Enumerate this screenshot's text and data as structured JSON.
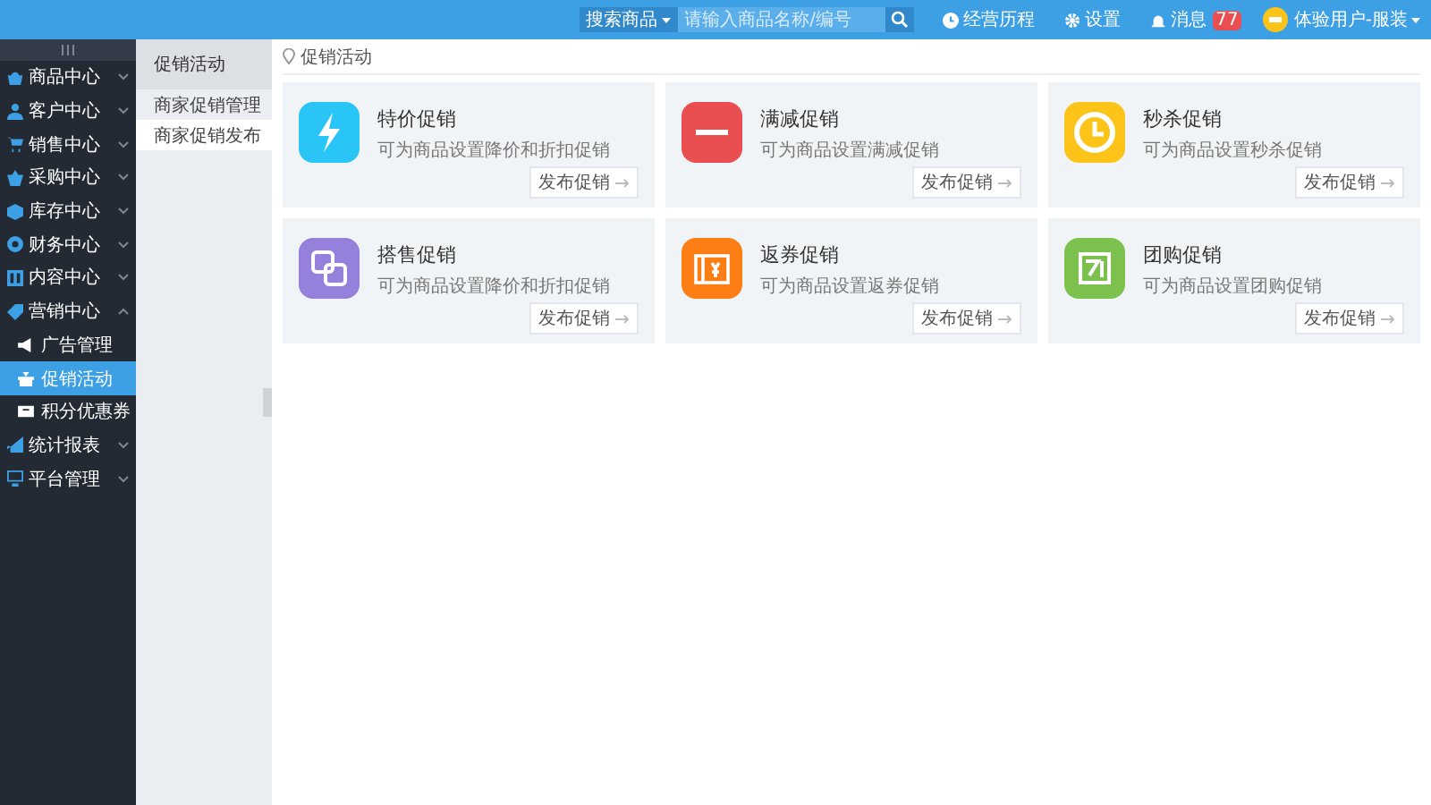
{
  "topbar": {
    "search": {
      "scope": "搜索商品",
      "placeholder": "请输入商品名称/编号"
    },
    "links": [
      {
        "kind": "history",
        "label": "经营历程"
      },
      {
        "kind": "settings",
        "label": "设置"
      },
      {
        "kind": "bell",
        "label": "消息",
        "badge": "77"
      }
    ],
    "user": "体验用户-服装"
  },
  "sidebar": {
    "items": [
      {
        "kind": "bag",
        "label": "商品中心",
        "expanded": false
      },
      {
        "kind": "person",
        "label": "客户中心",
        "expanded": false
      },
      {
        "kind": "cart",
        "label": "销售中心",
        "expanded": false
      },
      {
        "kind": "basket",
        "label": "采购中心",
        "expanded": false
      },
      {
        "kind": "cube",
        "label": "库存中心",
        "expanded": false
      },
      {
        "kind": "coin",
        "label": "财务中心",
        "expanded": false
      },
      {
        "kind": "columns",
        "label": "内容中心",
        "expanded": false
      },
      {
        "kind": "tag",
        "label": "营销中心",
        "expanded": true,
        "children": [
          {
            "kind": "megaphone",
            "label": "广告管理",
            "selected": false
          },
          {
            "kind": "gift",
            "label": "促销活动",
            "selected": true
          },
          {
            "kind": "ticket",
            "label": "积分优惠券",
            "selected": false
          }
        ]
      },
      {
        "kind": "chart",
        "label": "统计报表",
        "expanded": false
      },
      {
        "kind": "monitor",
        "label": "平台管理",
        "expanded": false
      }
    ]
  },
  "subnav": {
    "title": "促销活动",
    "items": [
      {
        "label": "商家促销管理",
        "selected": false
      },
      {
        "label": "商家促销发布",
        "selected": true
      }
    ]
  },
  "breadcrumb": "促销活动",
  "cards": [
    {
      "kind": "bolt",
      "color": "#29c5f6",
      "title": "特价促销",
      "description": "可为商品设置降价和折扣促销",
      "button": "发布促销"
    },
    {
      "kind": "minus",
      "color": "#e94e51",
      "title": "满减促销",
      "description": "可为商品设置满减促销",
      "button": "发布促销"
    },
    {
      "kind": "clock",
      "color": "#fcc419",
      "title": "秒杀促销",
      "description": "可为商品设置秒杀促销",
      "button": "发布促销"
    },
    {
      "kind": "squares",
      "color": "#9580dc",
      "title": "搭售促销",
      "description": "可为商品设置降价和折扣促销",
      "button": "发布促销"
    },
    {
      "kind": "coupon",
      "color": "#fd7e14",
      "title": "返券促销",
      "description": "可为商品设置返券促销",
      "button": "发布促销"
    },
    {
      "kind": "group",
      "color": "#7cc04e",
      "title": "团购促销",
      "description": "可为商品设置团购促销",
      "button": "发布促销"
    }
  ]
}
